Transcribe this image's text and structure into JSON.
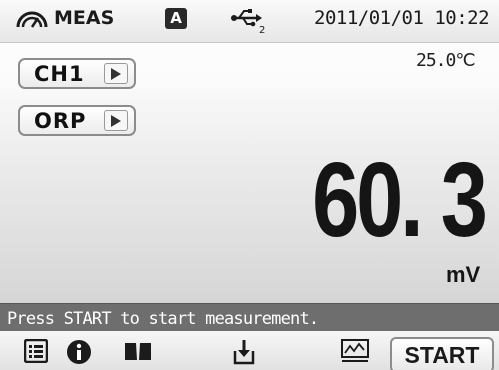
{
  "header": {
    "mode_icon": "gauge-icon",
    "mode_label": "MEAS",
    "auto_badge": "A",
    "usb_icon": "usb-icon",
    "usb_index": "2",
    "datetime": "2011/01/01 10:22"
  },
  "selectors": {
    "channel": "CH1",
    "parameter": "ORP"
  },
  "measurement": {
    "temperature": "25.0℃",
    "value": "60. 3",
    "unit": "mV"
  },
  "status": {
    "message": "Press START to start measurement."
  },
  "toolbar": {
    "icons": [
      "menu-list-icon",
      "info-icon",
      "book-icon",
      "save-data-icon",
      "graph-icon"
    ],
    "start_label": "START"
  }
}
